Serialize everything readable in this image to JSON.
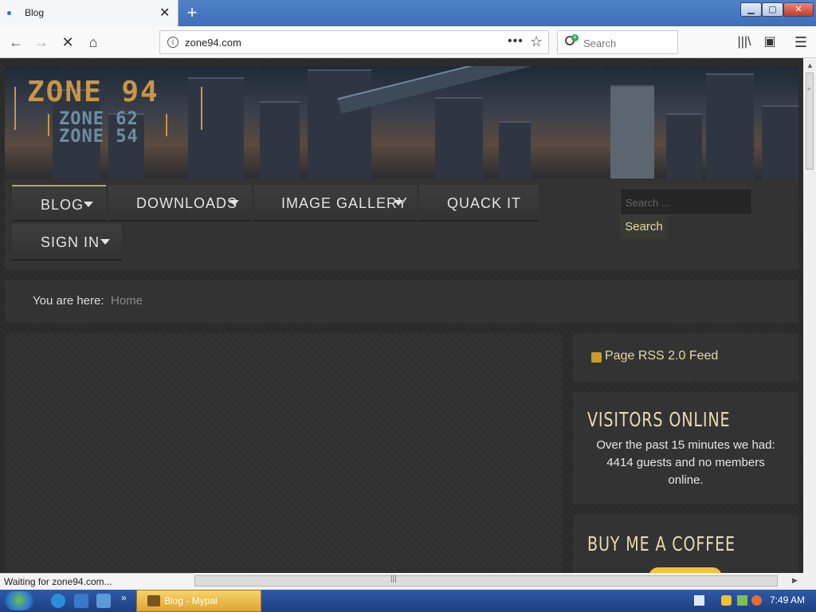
{
  "browser": {
    "tab_title": "Blog",
    "new_tab": "+",
    "url": "zone94.com",
    "search_placeholder": "Search",
    "status": "Waiting for zone94.com..."
  },
  "site": {
    "logo": {
      "main": "ZONE 94",
      "sub1": "ZONE 62",
      "sub2": "ZONE 54"
    },
    "menu": [
      {
        "label": "BLOG",
        "has_dropdown": true
      },
      {
        "label": "DOWNLOADS",
        "has_dropdown": true
      },
      {
        "label": "IMAGE GALLERY",
        "has_dropdown": true
      },
      {
        "label": "QUACK IT",
        "has_dropdown": false
      },
      {
        "label": "SIGN IN",
        "has_dropdown": true
      }
    ],
    "search": {
      "placeholder": "Search ...",
      "button": "Search"
    },
    "breadcrumb": {
      "label": "You are here:",
      "current": "Home"
    },
    "sidebar": {
      "rss": "Page RSS 2.0 Feed",
      "visitors_title": "VISITORS ONLINE",
      "visitors_text": "Over the past 15 minutes we had: 4414 guests and no members online.",
      "coffee_title": "BUY ME A COFFEE"
    }
  },
  "taskbar": {
    "active_window": "Blog - Mypal",
    "clock": "7:49 AM"
  },
  "colors": {
    "accent_gold": "#c99546",
    "heading_cream": "#eadab0",
    "taskbar_blue": "#2f5aa8"
  }
}
